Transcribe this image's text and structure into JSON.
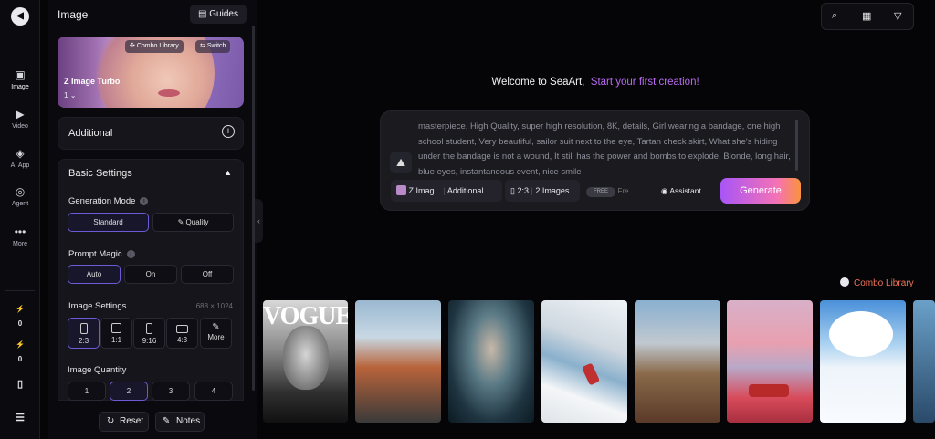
{
  "rail": {
    "items": [
      {
        "label": "Image",
        "icon": "image-icon"
      },
      {
        "label": "Video",
        "icon": "video-icon"
      },
      {
        "label": "AI App",
        "icon": "ai-app-icon"
      },
      {
        "label": "Agent",
        "icon": "agent-icon"
      },
      {
        "label": "More",
        "icon": "more-icon"
      }
    ],
    "counters": [
      "0",
      "0"
    ]
  },
  "panel": {
    "title": "Image",
    "guides_label": "Guides",
    "model": {
      "name": "Z Image Turbo",
      "version": "1",
      "combo_label": "Combo Library",
      "switch_label": "Switch"
    },
    "additional_label": "Additional",
    "basic_settings_label": "Basic Settings",
    "generation_mode": {
      "label": "Generation Mode",
      "options": [
        "Standard",
        "Quality"
      ],
      "selected": "Standard"
    },
    "prompt_magic": {
      "label": "Prompt Magic",
      "options": [
        "Auto",
        "On",
        "Off"
      ],
      "selected": "Auto"
    },
    "image_settings": {
      "label": "Image Settings",
      "size": "688 × 1024",
      "ratios": [
        "2:3",
        "1:1",
        "9:16",
        "4:3",
        "More"
      ],
      "selected": "2:3"
    },
    "image_quantity": {
      "label": "Image Quantity",
      "options": [
        "1",
        "2",
        "3",
        "4"
      ],
      "selected": "2"
    },
    "reset_label": "Reset",
    "notes_label": "Notes"
  },
  "main": {
    "welcome": "Welcome to SeaArt,",
    "welcome_highlight": "Start your first creation!",
    "prompt_text": "masterpiece, High Quality, super high resolution, 8K, details, Girl wearing a bandage, one high school student, Very beautiful, sailor suit next to the eye, Tartan check skirt, What she's hiding under the bandage is not a wound, It still has the power and bombs to explode, Blonde, long hair, blue eyes, instantaneous event, nice smile",
    "tags": {
      "model": "Z Imag...",
      "additional": "Additional",
      "ratio": "2:3",
      "count": "2 Images",
      "free": "FREE",
      "free_text": "Fre"
    },
    "assistant_label": "Assistant",
    "generate_label": "Generate",
    "combo_library": "Combo Library",
    "gallery_masthead": "VOGUE"
  },
  "colors": {
    "accent": "#b86af0",
    "generate_start": "#a855f7",
    "generate_end": "#fb923c",
    "combo": "#f0735a"
  }
}
